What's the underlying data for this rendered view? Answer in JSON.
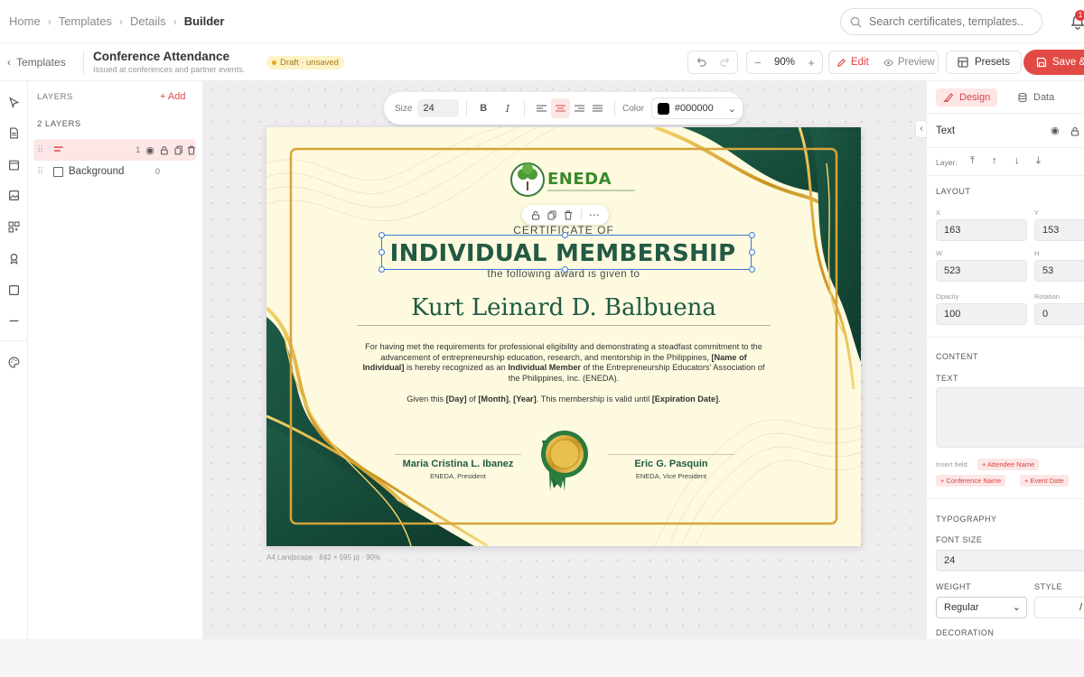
{
  "breadcrumb": [
    "Home",
    "Templates",
    "Details",
    "Builder"
  ],
  "search": {
    "placeholder": "Search certificates, templates.."
  },
  "notifications": {
    "count": "1"
  },
  "doc": {
    "back_label": "Templates",
    "title": "Conference Attendance",
    "subtitle": "Issued at conferences and partner events.",
    "status": "Draft · unsaved"
  },
  "toolbar": {
    "zoom": "90%",
    "edit": "Edit",
    "preview": "Preview",
    "presets": "Presets",
    "save": "Save &"
  },
  "layers": {
    "header": "LAYERS",
    "add": "+ Add",
    "count": "2 LAYERS",
    "items": [
      {
        "label": "",
        "num": "1"
      },
      {
        "label": "Background",
        "num": "0"
      }
    ]
  },
  "format_bar": {
    "size_label": "Size",
    "size": "24",
    "color_label": "Color",
    "color": "#000000"
  },
  "certificate": {
    "org": "ENEDA",
    "certificate_of": "CERTIFICATE OF",
    "headline": "INDIVIDUAL MEMBERSHIP",
    "given_to": "the following award is given to",
    "recipient": "Kurt Leinard D. Balbuena",
    "body_1": "For having met the requirements for professional eligibility and demonstrating a steadfast commitment to the advancement of entrepreneurship education, research, and mentorship in the Philippines, ",
    "body_name": "[Name of Individual]",
    "body_2": " is hereby recognized as an ",
    "body_member": "Individual Member",
    "body_3": " of the Entrepreneurship Educators' Association of the Philippines, Inc. (ENEDA).",
    "given_pre": "Given this ",
    "given_day": "[Day]",
    "given_of": " of ",
    "given_month": "[Month]",
    "given_comma": ", ",
    "given_year": "[Year]",
    "given_mid": ". This membership is valid until ",
    "given_exp": "[Expiration Date]",
    "given_end": ".",
    "sig1_name": "Maria Cristina L. Ibanez",
    "sig1_role": "ENEDA, President",
    "sig2_name": "Eric G. Pasquin",
    "sig2_role": "ENEDA, Vice President"
  },
  "canvas_meta": "A4 Landscape · 842 × 595 pt · 90%",
  "panel": {
    "tabs": [
      "Design",
      "Data"
    ],
    "element": "Text",
    "layer_label": "Layer:",
    "layout": "LAYOUT",
    "x_label": "X",
    "x": "163",
    "y_label": "Y",
    "y": "153",
    "w_label": "W",
    "w": "523",
    "h_label": "H",
    "h": "53",
    "opacity_label": "Opacity",
    "opacity": "100",
    "rotation_label": "Rotation",
    "rotation": "0",
    "content": "CONTENT",
    "text_label": "TEXT",
    "insert_field": "Insert field:",
    "fields": [
      "+ Attendee Name",
      "+ Conference Name",
      "+ Event Date"
    ],
    "typography": "TYPOGRAPHY",
    "font_size_label": "FONT SIZE",
    "font_size": "24",
    "weight_label": "WEIGHT",
    "weight": "Regular",
    "style_label": "STYLE",
    "style": "/",
    "decoration": "DECORATION"
  },
  "colors": {
    "accent": "#e24b45",
    "cert_green": "#225a45",
    "cert_gold": "#d4a52a",
    "cert_bg": "#fefadf"
  }
}
